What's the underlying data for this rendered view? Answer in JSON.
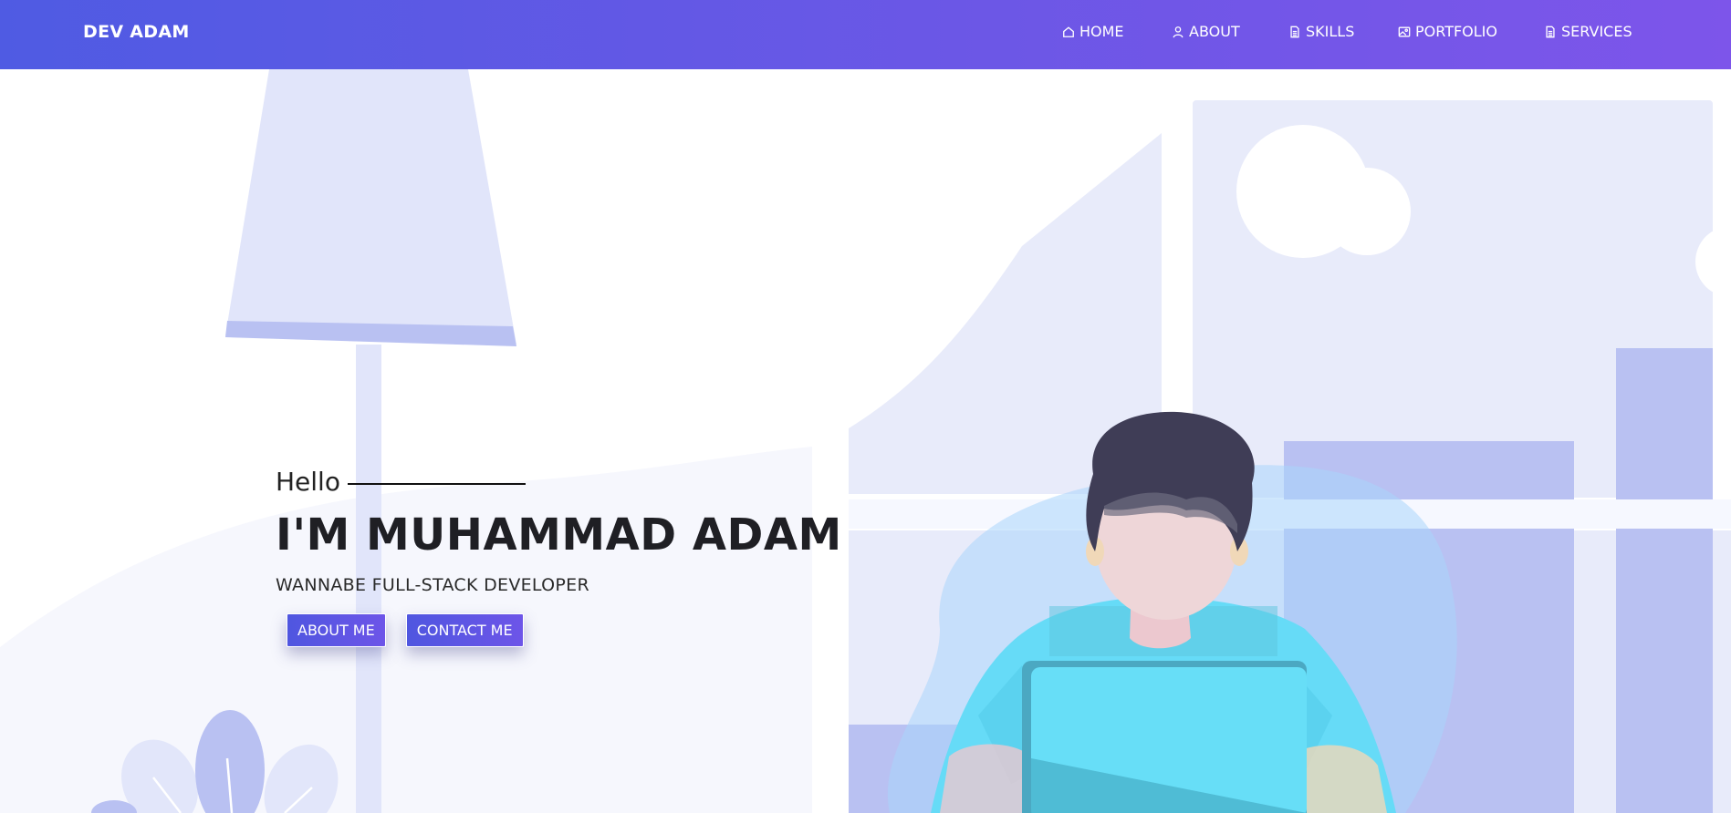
{
  "brand": "DEV ADAM",
  "nav": [
    {
      "label": "HOME",
      "icon": "home-icon"
    },
    {
      "label": "ABOUT",
      "icon": "user-icon"
    },
    {
      "label": "SKILLS",
      "icon": "document-icon"
    },
    {
      "label": "PORTFOLIO",
      "icon": "image-icon"
    },
    {
      "label": "SERVICES",
      "icon": "document-icon"
    }
  ],
  "hero": {
    "greeting": "Hello",
    "name": "I'M MUHAMMAD ADAM",
    "role": "WANNABE FULL-STACK DEVELOPER",
    "about_button": "ABOUT ME",
    "contact_button": "CONTACT ME"
  },
  "colors": {
    "navbar_start": "#4f5be3",
    "navbar_end": "#7d55ea",
    "button": "#5a56e4"
  }
}
